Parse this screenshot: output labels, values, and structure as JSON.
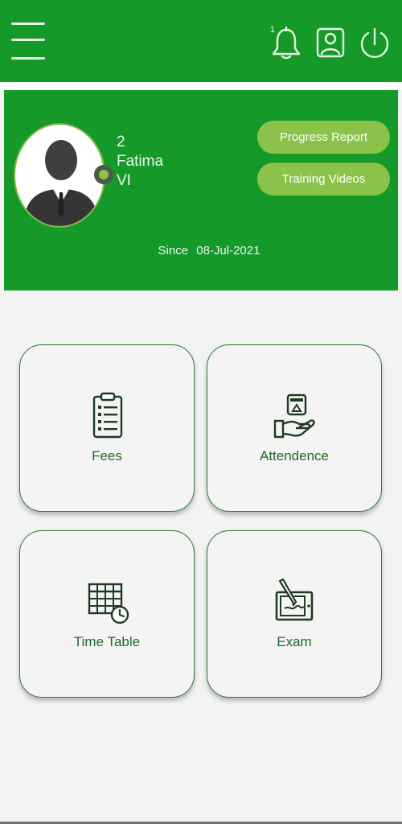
{
  "header": {
    "notification_count": "1",
    "icons": [
      "menu-icon",
      "bell-icon",
      "profile-icon",
      "power-icon"
    ],
    "color": "#159a2a"
  },
  "profile": {
    "roll": "2",
    "name": "Fatima",
    "class": "VI",
    "since_label": "Since",
    "since_date": "08-Jul-2021",
    "status_color": "#8bc34a"
  },
  "actions": {
    "progress_report": "Progress Report",
    "training_videos": "Training Videos"
  },
  "tiles": [
    {
      "label": "Fees",
      "icon": "clipboard-list-icon"
    },
    {
      "label": "Attendence",
      "icon": "hand-card-icon"
    },
    {
      "label": "Time Table",
      "icon": "timetable-clock-icon"
    },
    {
      "label": "Exam",
      "icon": "tablet-pen-icon"
    }
  ]
}
